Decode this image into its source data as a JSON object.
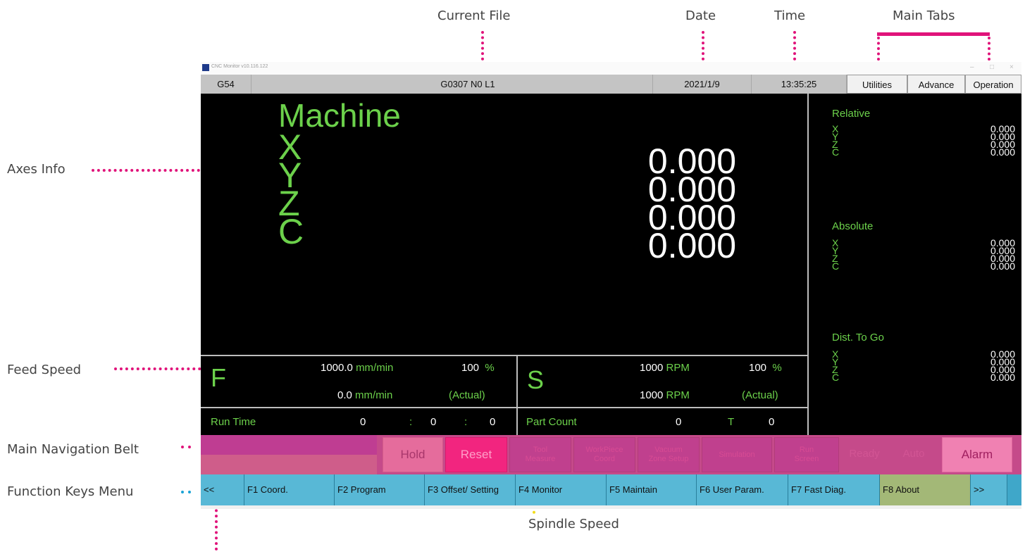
{
  "annotations": {
    "current_file": "Current File",
    "date": "Date",
    "time": "Time",
    "main_tabs": "Main Tabs",
    "axes_info": "Axes Info",
    "feed_speed": "Feed Speed",
    "main_navigation_belt": "Main Navigation Belt",
    "function_keys_menu": "Function Keys Menu",
    "spindle_speed": "Spindle Speed"
  },
  "window": {
    "title": "CNC Monitor v10.116.122",
    "controls": [
      "–",
      "□",
      "×"
    ]
  },
  "topbar": {
    "coord_system": "G54",
    "current_file": "G0307 N0 L1",
    "date": "2021/1/9",
    "time": "13:35:25",
    "tabs": [
      "Utilities",
      "Advance",
      "Operation"
    ]
  },
  "machine": {
    "heading": "Machine",
    "axes": [
      "X",
      "Y",
      "Z",
      "C"
    ],
    "values": [
      "0.000",
      "0.000",
      "0.000",
      "0.000"
    ]
  },
  "side": {
    "relative": {
      "label": "Relative",
      "axes": [
        "X",
        "Y",
        "Z",
        "C"
      ],
      "values": [
        "0.000",
        "0.000",
        "0.000",
        "0.000"
      ]
    },
    "absolute": {
      "label": "Absolute",
      "axes": [
        "X",
        "Y",
        "Z",
        "C"
      ],
      "values": [
        "0.000",
        "0.000",
        "0.000",
        "0.000"
      ]
    },
    "dist_to_go": {
      "label": "Dist. To Go",
      "axes": [
        "X",
        "Y",
        "Z",
        "C"
      ],
      "values": [
        "0.000",
        "0.000",
        "0.000",
        "0.000"
      ]
    }
  },
  "feed": {
    "letter": "F",
    "command_value": "1000.0",
    "command_unit": "mm/min",
    "override": "100",
    "override_unit": "%",
    "actual_value": "0.0",
    "actual_unit": "mm/min",
    "actual_label": "(Actual)"
  },
  "spindle": {
    "letter": "S",
    "command_value": "1000",
    "command_unit": "RPM",
    "override": "100",
    "override_unit": "%",
    "actual_value": "1000",
    "actual_unit": "RPM",
    "actual_label": "(Actual)"
  },
  "run_time": {
    "label": "Run Time",
    "h": "0",
    "sep1": ":",
    "m": "0",
    "sep2": ":",
    "s": "0"
  },
  "part_count": {
    "label": "Part Count",
    "value": "0",
    "t_label": "T",
    "t_value": "0"
  },
  "belt": {
    "hold": "Hold",
    "reset": "Reset",
    "tool_measure_1": "Tool",
    "tool_measure_2": "Measure",
    "workpiece_1": "WorkPiece",
    "workpiece_2": "Coord",
    "vacuum_1": "Vacuum",
    "vacuum_2": "Zone Setup",
    "simulation": "Simulation",
    "run_screen_1": "Run",
    "run_screen_2": "Screen",
    "ready": "Ready",
    "auto": "Auto",
    "alarm": "Alarm"
  },
  "fkeys": {
    "prev": "<<",
    "f1": "F1 Coord.",
    "f2": "F2 Program",
    "f3": "F3 Offset/ Setting",
    "f4": "F4 Monitor",
    "f5": "F5 Maintain",
    "f6": "F6 User Param.",
    "f7": "F7 Fast Diag.",
    "f8": "F8 About",
    "next": ">>"
  },
  "colors": {
    "accent_pink": "#e0137a",
    "readout_green": "#6cd14b",
    "belt_magenta": "#c54a8a",
    "fkey_blue": "#58b8d6",
    "f8_olive": "#a3b877"
  }
}
